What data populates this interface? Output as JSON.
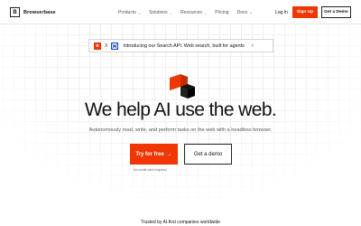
{
  "header": {
    "logo_letter": "B",
    "logo_text": "Browserbase",
    "nav": [
      {
        "label": "Products",
        "chevron": "chevron-down-icon"
      },
      {
        "label": "Solutions",
        "chevron": "chevron-down-icon"
      },
      {
        "label": "Resources",
        "chevron": "chevron-down-icon"
      },
      {
        "label": "Pricing"
      },
      {
        "label": "Docs",
        "icon": "external-link-icon"
      }
    ],
    "login_label": "Log In",
    "signup_label": "Sign Up",
    "demo_label": "Get a Demo"
  },
  "announcement": {
    "brand_letter": "B",
    "separator": "X",
    "partner_icon": "exa-logo-icon",
    "text": "Introducing our Search API: Web search, built for agents",
    "arrow": "›"
  },
  "hero": {
    "headline": "We help AI use the web.",
    "subheadline": "Autonomously read, write, and perform tasks on the web with a headless browser.",
    "try_label": "Try for free",
    "try_arrow": "→",
    "demo_label": "Get a demo",
    "no_card_note": "No credit card required."
  },
  "footer": {
    "trusted_text": "Trusted by AI-first companies worldwide"
  },
  "colors": {
    "accent": "#f03603",
    "text": "#111111",
    "partner_blue": "#1f40d0"
  }
}
